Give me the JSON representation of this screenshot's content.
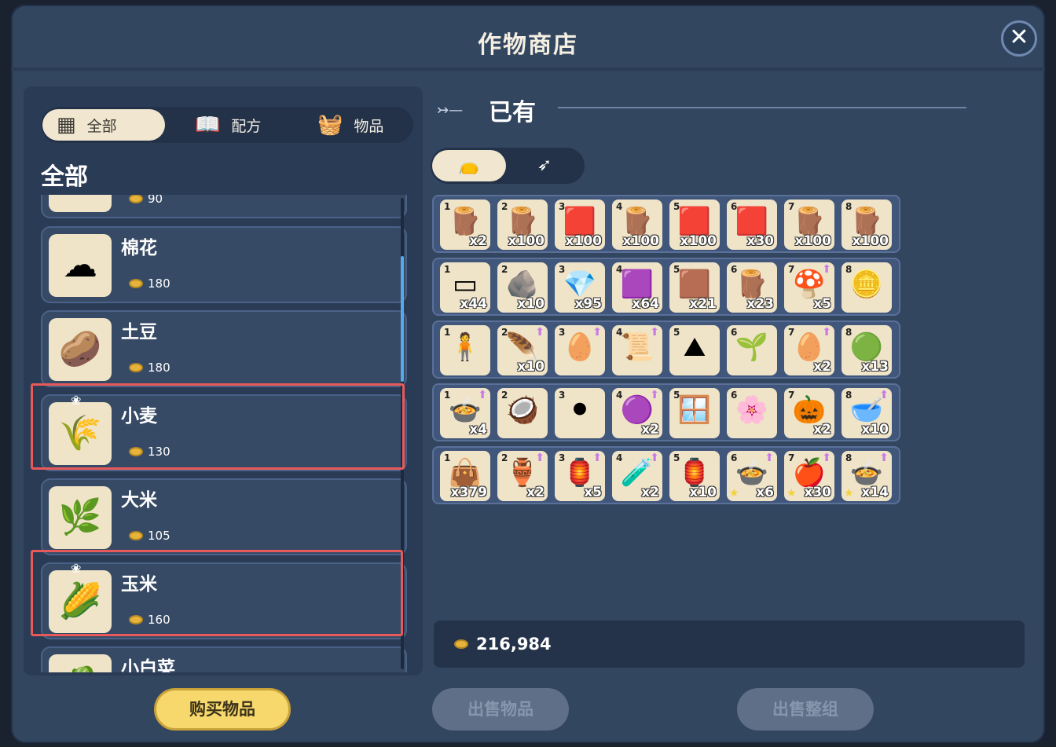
{
  "window": {
    "title": "作物商店",
    "close_icon": "close-icon"
  },
  "left": {
    "tabs": [
      {
        "label": "全部",
        "icon": "grid-icon",
        "glyph": "▦"
      },
      {
        "label": "配方",
        "icon": "book-icon",
        "glyph": "📖"
      },
      {
        "label": "物品",
        "icon": "basket-icon",
        "glyph": "🧺"
      }
    ],
    "section_title": "全部",
    "items": [
      {
        "name": "",
        "price": "90",
        "glyph": ""
      },
      {
        "name": "棉花",
        "price": "180",
        "glyph": "☁"
      },
      {
        "name": "土豆",
        "price": "180",
        "glyph": "🥔"
      },
      {
        "name": "小麦",
        "price": "130",
        "glyph": "🌾"
      },
      {
        "name": "大米",
        "price": "105",
        "glyph": "🌿"
      },
      {
        "name": "玉米",
        "price": "160",
        "glyph": "🌽"
      },
      {
        "name": "小白菜",
        "price": "",
        "glyph": "🥬"
      }
    ],
    "buy_label": "购买物品"
  },
  "right": {
    "owned_title": "已有",
    "toggle_icons": [
      "bag-icon",
      "feather-icon"
    ],
    "rows": [
      [
        {
          "n": "1",
          "q": "x2",
          "g": "🪵"
        },
        {
          "n": "2",
          "q": "x100",
          "g": "🪵"
        },
        {
          "n": "3",
          "q": "x100",
          "g": "🟥"
        },
        {
          "n": "4",
          "q": "x100",
          "g": "🪵"
        },
        {
          "n": "5",
          "q": "x100",
          "g": "🟥"
        },
        {
          "n": "6",
          "q": "x30",
          "g": "🟥"
        },
        {
          "n": "7",
          "q": "x100",
          "g": "🪵"
        },
        {
          "n": "8",
          "q": "x100",
          "g": "🪵"
        }
      ],
      [
        {
          "n": "1",
          "q": "x44",
          "g": "▭"
        },
        {
          "n": "2",
          "q": "x10",
          "g": "🪨"
        },
        {
          "n": "3",
          "q": "x95",
          "g": "💎"
        },
        {
          "n": "4",
          "q": "x64",
          "g": "🟪"
        },
        {
          "n": "5",
          "q": "x21",
          "g": "🟫"
        },
        {
          "n": "6",
          "q": "x23",
          "g": "🪵"
        },
        {
          "n": "7",
          "q": "x5",
          "g": "🍄",
          "up": true
        },
        {
          "n": "8",
          "q": "",
          "g": "🪙"
        }
      ],
      [
        {
          "n": "1",
          "q": "",
          "g": "🧍"
        },
        {
          "n": "2",
          "q": "x10",
          "g": "🪶",
          "up": true
        },
        {
          "n": "3",
          "q": "",
          "g": "🥚",
          "up": true
        },
        {
          "n": "4",
          "q": "",
          "g": "📜",
          "up": true
        },
        {
          "n": "5",
          "q": "",
          "g": "⛰"
        },
        {
          "n": "6",
          "q": "",
          "g": "🌱"
        },
        {
          "n": "7",
          "q": "x2",
          "g": "🥚",
          "up": true
        },
        {
          "n": "8",
          "q": "x13",
          "g": "🟢"
        }
      ],
      [
        {
          "n": "1",
          "q": "x4",
          "g": "🍲",
          "up": true
        },
        {
          "n": "2",
          "q": "",
          "g": "🥥"
        },
        {
          "n": "3",
          "q": "",
          "g": "⚫"
        },
        {
          "n": "4",
          "q": "x2",
          "g": "🟣",
          "up": true
        },
        {
          "n": "5",
          "q": "",
          "g": "🪟"
        },
        {
          "n": "6",
          "q": "",
          "g": "🌸"
        },
        {
          "n": "7",
          "q": "x2",
          "g": "🎃"
        },
        {
          "n": "8",
          "q": "x10",
          "g": "🥣",
          "up": true
        }
      ],
      [
        {
          "n": "1",
          "q": "x379",
          "g": "👜"
        },
        {
          "n": "2",
          "q": "x2",
          "g": "🏺",
          "up": true
        },
        {
          "n": "3",
          "q": "x5",
          "g": "🏮",
          "up": true
        },
        {
          "n": "4",
          "q": "x2",
          "g": "🧪",
          "up": true
        },
        {
          "n": "5",
          "q": "x10",
          "g": "🏮"
        },
        {
          "n": "6",
          "q": "x6",
          "g": "🍲",
          "up": true,
          "star": true
        },
        {
          "n": "7",
          "q": "x30",
          "g": "🍎",
          "up": true,
          "star": true
        },
        {
          "n": "8",
          "q": "x14",
          "g": "🍲",
          "up": true,
          "star": true
        }
      ]
    ],
    "money": "216,984",
    "sell_label": "出售物品",
    "sell_group_label": "出售整组"
  }
}
